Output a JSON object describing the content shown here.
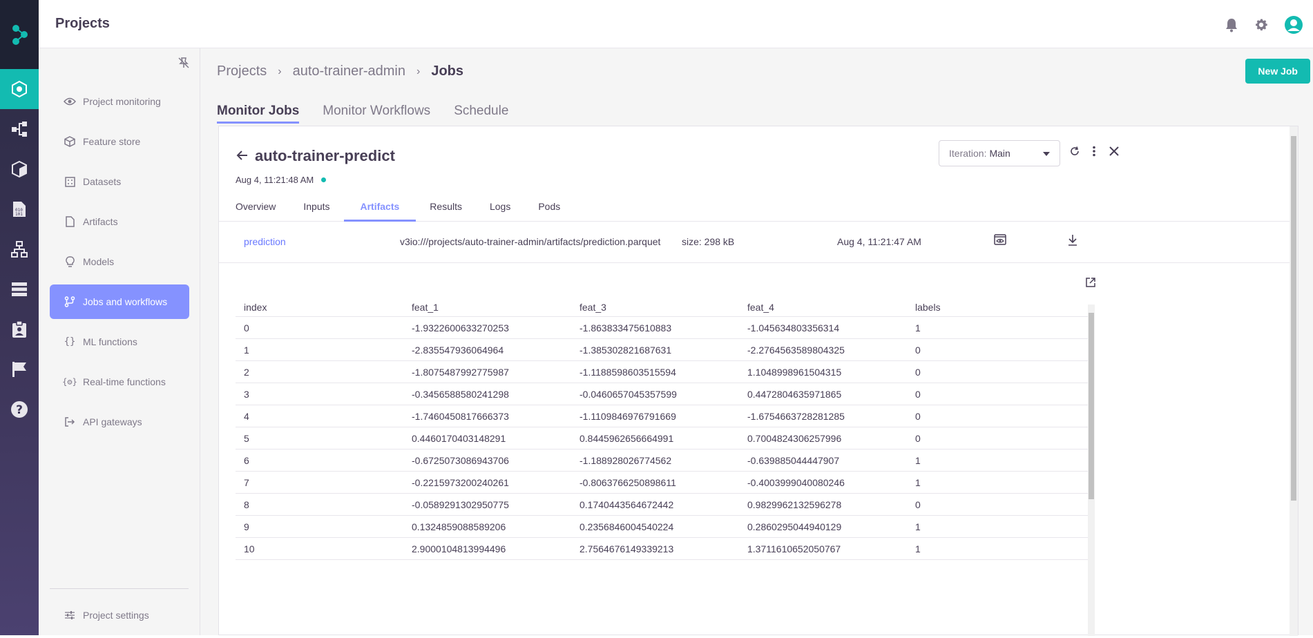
{
  "app": {
    "title": "Projects"
  },
  "rail": {
    "items": [
      "logo-icon",
      "projects-icon",
      "flow-icon",
      "cube-icon",
      "binary-doc-icon",
      "graph-icon",
      "list-icon",
      "clipboard-icon",
      "flag-icon",
      "help-icon"
    ]
  },
  "sidebar": {
    "items": [
      {
        "label": "Project monitoring",
        "icon": "eye-icon"
      },
      {
        "label": "Feature store",
        "icon": "package-icon"
      },
      {
        "label": "Datasets",
        "icon": "grid-icon"
      },
      {
        "label": "Artifacts",
        "icon": "file-icon"
      },
      {
        "label": "Models",
        "icon": "bulb-icon"
      },
      {
        "label": "Jobs and workflows",
        "icon": "branch-icon"
      },
      {
        "label": "ML functions",
        "icon": "braces-icon"
      },
      {
        "label": "Real-time functions",
        "icon": "gear-braces-icon"
      },
      {
        "label": "API gateways",
        "icon": "gateway-icon"
      }
    ],
    "settings_label": "Project settings"
  },
  "breadcrumb": {
    "root": "Projects",
    "project": "auto-trainer-admin",
    "current": "Jobs"
  },
  "new_job_label": "New Job",
  "main_tabs": [
    "Monitor Jobs",
    "Monitor Workflows",
    "Schedule"
  ],
  "job": {
    "name": "auto-trainer-predict",
    "date": "Aug 4, 11:21:48 AM",
    "iteration_label": "Iteration:",
    "iteration_value": "Main"
  },
  "detail_tabs": [
    "Overview",
    "Inputs",
    "Artifacts",
    "Results",
    "Logs",
    "Pods"
  ],
  "artifact": {
    "name": "prediction",
    "path": "v3io:///projects/auto-trainer-admin/artifacts/prediction.parquet",
    "size": "size: 298 kB",
    "date": "Aug 4, 11:21:47 AM"
  },
  "table": {
    "columns": [
      "index",
      "feat_1",
      "feat_3",
      "feat_4",
      "labels"
    ],
    "rows": [
      [
        "0",
        "-1.9322600633270253",
        "-1.863833475610883",
        "-1.045634803356314",
        "1"
      ],
      [
        "1",
        "-2.835547936064964",
        "-1.385302821687631",
        "-2.2764563589804325",
        "0"
      ],
      [
        "2",
        "-1.8075487992775987",
        "-1.1188598603515594",
        "1.1048998961504315",
        "0"
      ],
      [
        "3",
        "-0.3456588580241298",
        "-0.0460657045357599",
        "0.4472804635971865",
        "0"
      ],
      [
        "4",
        "-1.7460450817666373",
        "-1.1109846976791669",
        "-1.6754663728281285",
        "0"
      ],
      [
        "5",
        "0.4460170403148291",
        "0.8445962656664991",
        "0.7004824306257996",
        "0"
      ],
      [
        "6",
        "-0.6725073086943706",
        "-1.188928026774562",
        "-0.639885044447907",
        "1"
      ],
      [
        "7",
        "-0.2215973200240261",
        "-0.8063766250898611",
        "-0.4003999040080246",
        "1"
      ],
      [
        "8",
        "-0.0589291302950775",
        "0.1740443564672442",
        "0.9829962132596278",
        "0"
      ],
      [
        "9",
        "0.1324859088589206",
        "0.2356846004540224",
        "0.2860295044940129",
        "1"
      ],
      [
        "10",
        "2.9000104813994496",
        "2.7564676149339213",
        "1.3711610652050767",
        "1"
      ]
    ]
  },
  "colors": {
    "accent": "#13bbb1",
    "primary": "#8592ff",
    "text": "#483f56",
    "muted": "#7f7989"
  }
}
